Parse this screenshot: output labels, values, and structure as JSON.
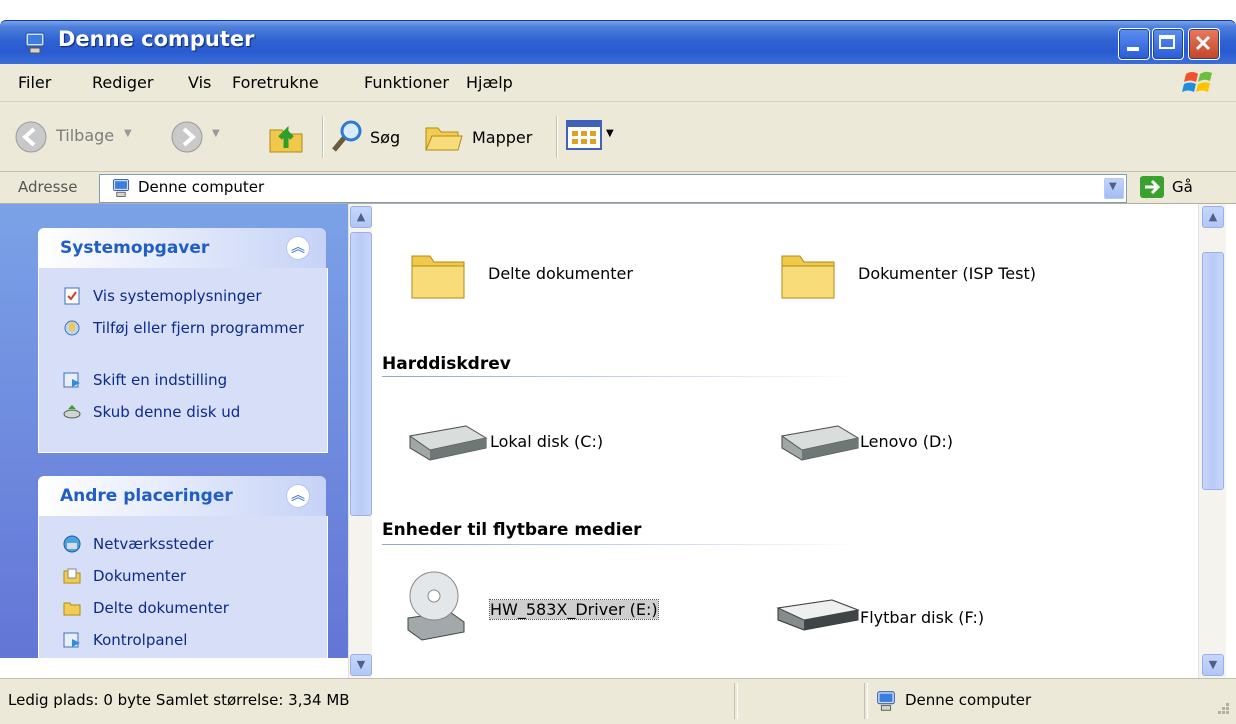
{
  "window": {
    "title": "Denne computer"
  },
  "menu": {
    "items": [
      "Filer",
      "Rediger",
      "Vis",
      "Foretrukne",
      "Funktioner",
      "Hjælp"
    ]
  },
  "toolbar": {
    "back_label": "Tilbage",
    "search_label": "Søg",
    "folders_label": "Mapper"
  },
  "address": {
    "label": "Adresse",
    "value": "Denne computer",
    "go_label": "Gå"
  },
  "taskpane": {
    "system": {
      "title": "Systemopgaver",
      "items": [
        "Vis systemoplysninger",
        "Tilføj eller fjern programmer",
        "Skift en indstilling",
        "Skub denne disk ud"
      ]
    },
    "other": {
      "title": "Andre placeringer",
      "items": [
        "Netværkssteder",
        "Dokumenter",
        "Delte dokumenter",
        "Kontrolpanel"
      ]
    }
  },
  "content": {
    "folders": [
      "Delte dokumenter",
      "Dokumenter (ISP Test)"
    ],
    "harddisk_group": "Harddiskdrev",
    "harddisks": [
      "Lokal disk (C:)",
      "Lenovo (D:)"
    ],
    "removable_group": "Enheder til flytbare medier",
    "removable": [
      "HW_583X_Driver (E:)",
      "Flytbar disk (F:)"
    ]
  },
  "status": {
    "left": "Ledig plads: 0 byte Samlet størrelse: 3,34 MB",
    "right": "Denne computer"
  },
  "colors": {
    "titlebar": "#2f63d2",
    "taskpane_bg": "#7ba2e7",
    "panel_title": "#215dc6",
    "chrome": "#ece9d8"
  }
}
